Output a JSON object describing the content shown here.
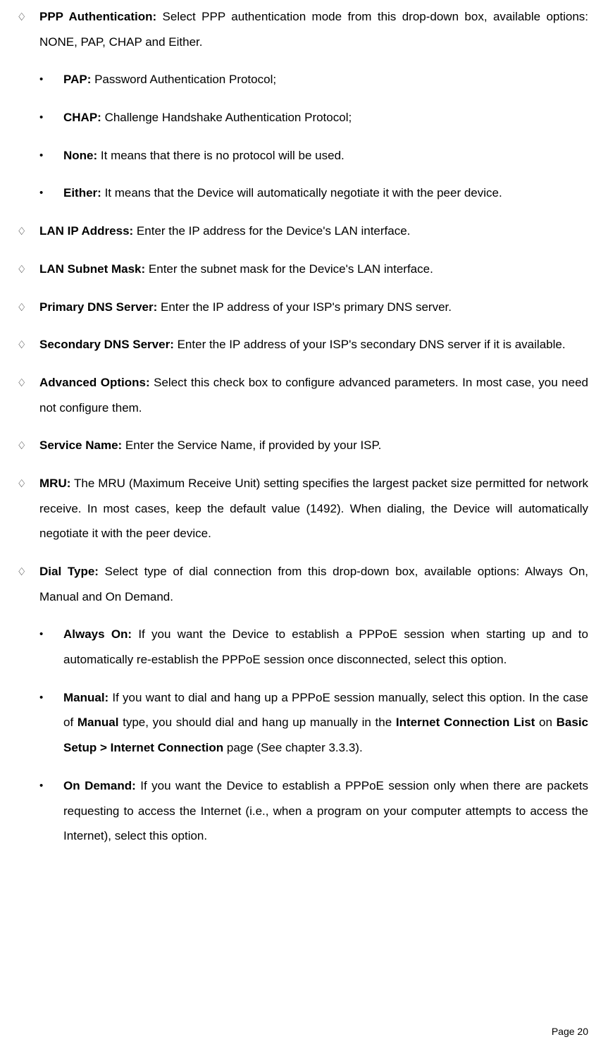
{
  "items": [
    {
      "type": "diamond",
      "label": "PPP Authentication:",
      "text": " Select PPP authentication mode from this drop-down box, available options: NONE, PAP, CHAP and Either."
    },
    {
      "type": "dot",
      "label": "PAP:",
      "text": " Password Authentication Protocol;"
    },
    {
      "type": "dot",
      "label": "CHAP:",
      "text": " Challenge Handshake Authentication Protocol;"
    },
    {
      "type": "dot",
      "label": "None:",
      "text": " It means that there is no protocol will be used."
    },
    {
      "type": "dot",
      "label": "Either:",
      "text": " It means that the Device will automatically negotiate it with the peer device."
    },
    {
      "type": "diamond",
      "label": "LAN IP Address:",
      "text": " Enter the IP address for the Device's LAN interface."
    },
    {
      "type": "diamond",
      "label": "LAN Subnet Mask:",
      "text": " Enter the subnet mask for the Device's LAN interface."
    },
    {
      "type": "diamond",
      "label": "Primary DNS Server:",
      "text": " Enter the IP address of your ISP's primary DNS server."
    },
    {
      "type": "diamond",
      "label": "Secondary DNS Server:",
      "text": " Enter the IP address of your ISP's secondary DNS server if it is available."
    },
    {
      "type": "diamond",
      "label": "Advanced Options:",
      "text": " Select this check box to configure advanced parameters. In most case, you need not configure them."
    },
    {
      "type": "diamond",
      "label": "Service Name:",
      "text": " Enter the Service Name, if provided by your ISP."
    },
    {
      "type": "diamond",
      "label": "MRU:",
      "text": " The MRU (Maximum Receive Unit) setting specifies the largest packet size permitted for network receive. In most cases, keep the default value (1492). When dialing, the Device will automatically negotiate it with the peer device."
    },
    {
      "type": "diamond",
      "label": "Dial Type:",
      "text": " Select type of dial connection from this drop-down box, available options: Always On, Manual and On Demand."
    },
    {
      "type": "dot",
      "label": "Always On:",
      "text": " If you want the Device to establish a PPPoE session when starting up and to automatically re-establish the PPPoE session once disconnected, select this option."
    },
    {
      "type": "dot",
      "label": "Manual:",
      "runs": [
        {
          "t": " If you want to dial and hang up a PPPoE session manually, select this option. In the case of ",
          "b": false
        },
        {
          "t": "Manual",
          "b": true
        },
        {
          "t": " type, you should dial and hang up manually in the ",
          "b": false
        },
        {
          "t": "Internet Connection List",
          "b": true
        },
        {
          "t": " on ",
          "b": false
        },
        {
          "t": "Basic Setup > Internet Connection",
          "b": true
        },
        {
          "t": " page (See chapter 3.3.3).",
          "b": false
        }
      ]
    },
    {
      "type": "dot",
      "label": "On Demand:",
      "text": " If you want the Device to establish a PPPoE session only when there are packets requesting to access the Internet (i.e., when a program on your computer attempts to access the Internet), select this option."
    }
  ],
  "bullets": {
    "diamond": "♢",
    "dot": "•"
  },
  "footer": "Page 20"
}
